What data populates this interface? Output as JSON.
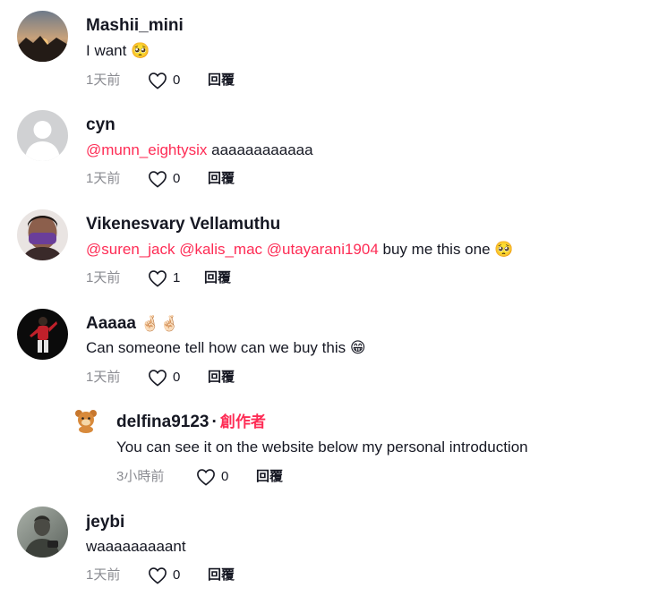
{
  "comments": [
    {
      "username": "Mashii_mini",
      "text": "I want ",
      "emoji": "🥺",
      "time": "1天前",
      "likes": "0",
      "reply": "回覆"
    },
    {
      "username": "cyn",
      "mention": "@munn_eightysix",
      "text": " aaaaaaaaaaaa",
      "time": "1天前",
      "likes": "0",
      "reply": "回覆"
    },
    {
      "username": "Vikenesvary Vellamuthu",
      "mentions": [
        "@suren_jack",
        "@kalis_mac",
        "@utayarani1904"
      ],
      "text": " buy me this one ",
      "emoji": "🥺",
      "time": "1天前",
      "likes": "1",
      "reply": "回覆"
    },
    {
      "username": "Aaaaa",
      "username_emoji": "🤞🏻🤞🏻",
      "text": "Can someone tell how can we buy this ",
      "emoji": "😁",
      "time": "1天前",
      "likes": "0",
      "reply": "回覆"
    },
    {
      "username": "delfina9123",
      "dot": "·",
      "author_tag": "創作者",
      "text": "You can see it on the website below my personal introduction",
      "time": "3小時前",
      "likes": "0",
      "reply": "回覆"
    },
    {
      "username": "jeybi",
      "text": "waaaaaaaaant",
      "time": "1天前",
      "likes": "0",
      "reply": "回覆"
    }
  ],
  "colors": {
    "accent": "#fe2c55",
    "text": "#161823",
    "muted": "#8a8b91"
  }
}
